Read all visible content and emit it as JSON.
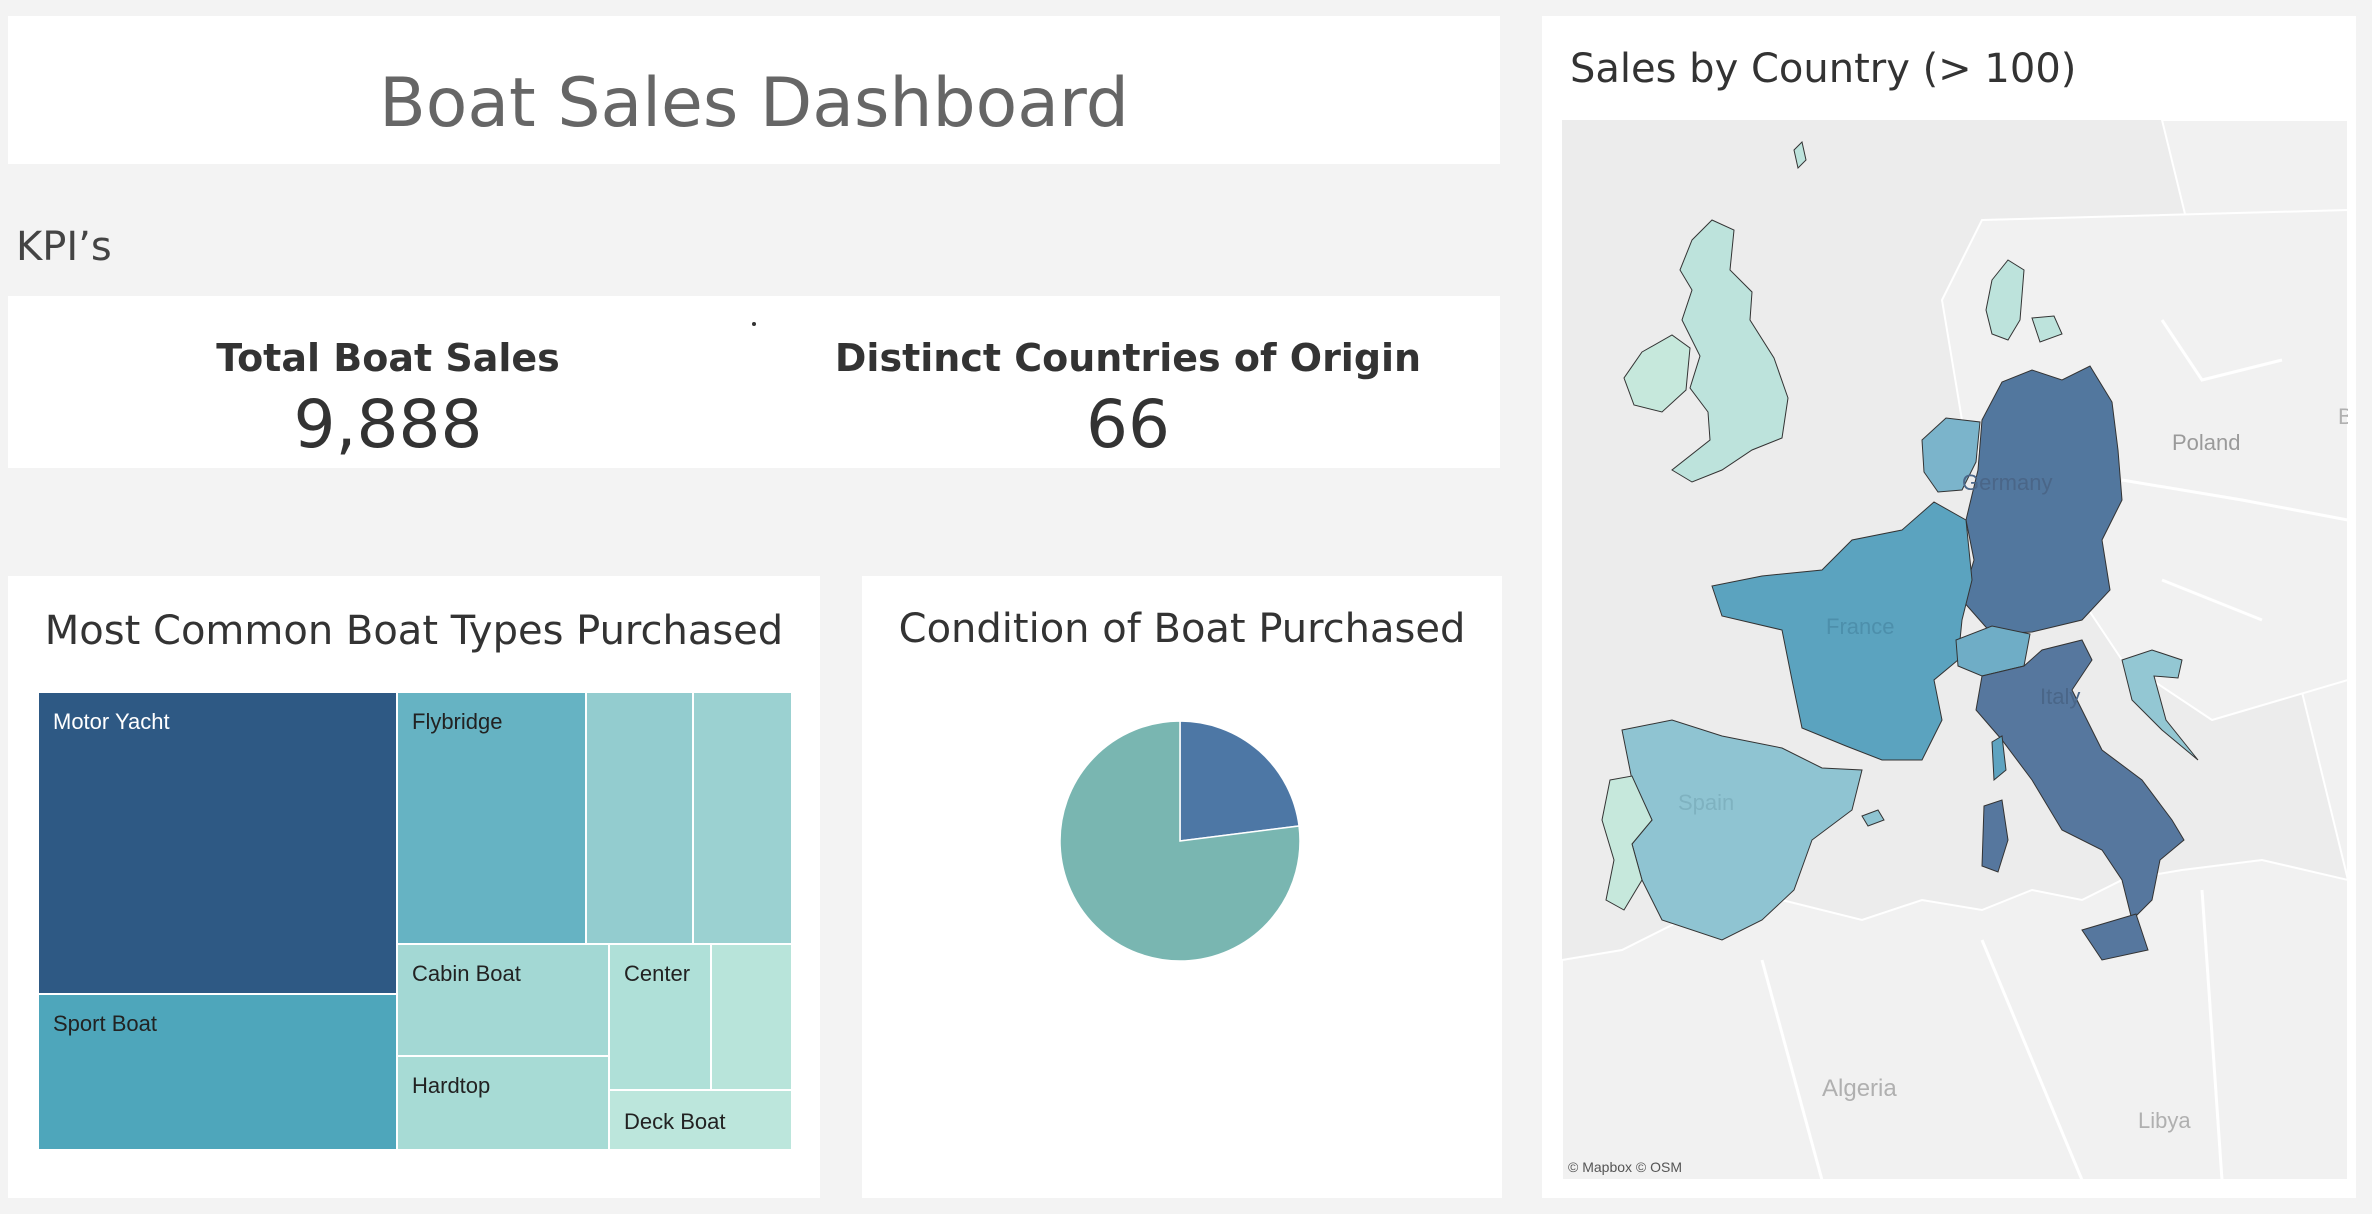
{
  "header": {
    "title": "Boat Sales Dashboard"
  },
  "kpis": {
    "heading": "KPI’s",
    "total_sales": {
      "label": "Total Boat Sales",
      "value": "9,888"
    },
    "countries": {
      "label": "Distinct Countries of Origin",
      "value": "66"
    }
  },
  "treemap": {
    "title": "Most Common Boat Types Purchased",
    "tiles": [
      {
        "label": "Motor Yacht",
        "color": "#2e5984",
        "text_color": "#ffffff"
      },
      {
        "label": "Sport Boat",
        "color": "#4ea6bb",
        "text_color": "#222222"
      },
      {
        "label": "Flybridge",
        "color": "#66b3c3",
        "text_color": "#222222"
      },
      {
        "label": "",
        "color": "#93cccf",
        "text_color": "#222222"
      },
      {
        "label": "",
        "color": "#9bd1d1",
        "text_color": "#222222"
      },
      {
        "label": "Cabin Boat",
        "color": "#a3d8d4",
        "text_color": "#222222"
      },
      {
        "label": "Hardtop",
        "color": "#a7dbd5",
        "text_color": "#222222"
      },
      {
        "label": "Center",
        "color": "#afe0d8",
        "text_color": "#222222"
      },
      {
        "label": "",
        "color": "#b8e4da",
        "text_color": "#222222"
      },
      {
        "label": "Deck Boat",
        "color": "#bce6dc",
        "text_color": "#222222"
      }
    ]
  },
  "chart_data": [
    {
      "type": "pie",
      "title": "Condition of Boat Purchased",
      "slices": [
        {
          "value": 23,
          "color": "#4d77a5"
        },
        {
          "value": 77,
          "color": "#79b6b1"
        }
      ]
    }
  ],
  "map": {
    "title": "Sales by Country (> 100)",
    "attribution": "© Mapbox © OSM",
    "basemap_labels": {
      "poland": "Poland",
      "algeria": "Algeria",
      "libya": "Libya",
      "edge": "B"
    },
    "country_labels": {
      "germany": "Germany",
      "france": "France",
      "spain": "Spain",
      "italy": "Italy"
    },
    "colors": {
      "germany": "#52779e",
      "italy": "#56779e",
      "france": "#5ba3bf",
      "spain": "#8fc4d2",
      "uk": "#bde3dc",
      "netherlands": "#7bb4cb",
      "switzerland": "#6fadc6",
      "denmark": "#bde3dc",
      "portugal": "#c6e8dc",
      "croatia": "#93c7d3",
      "ireland": "#c6e8dc",
      "corsica": "#5ea3c0"
    }
  }
}
